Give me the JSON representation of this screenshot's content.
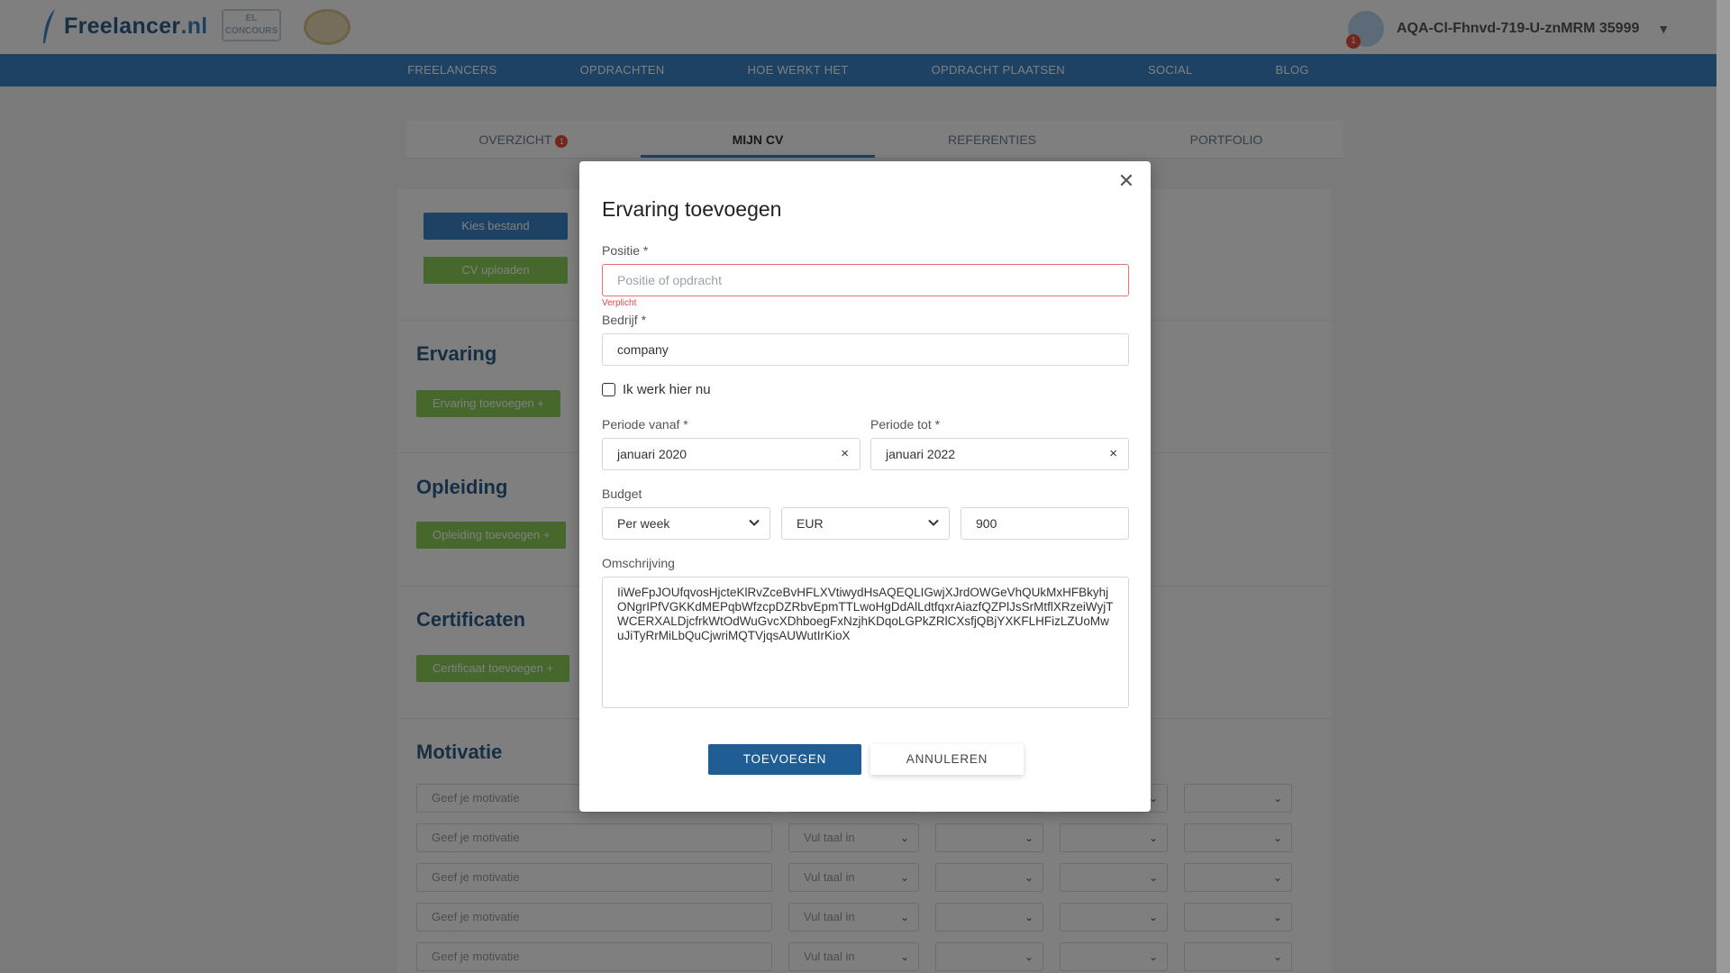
{
  "app": {
    "logo_text_main": "Freelancer",
    "logo_text_suffix": ".nl",
    "award_badge_text": "EL\nCONCOURS",
    "user_name": "AQA-Cl-Fhnvd-719-U-znMRM 35999",
    "user_notification_count": "1"
  },
  "nav": {
    "items": [
      "FREELANCERS",
      "OPDRACHTEN",
      "HOE WERKT HET",
      "OPDRACHT PLAATSEN",
      "SOCIAL",
      "BLOG"
    ]
  },
  "subtabs": {
    "items": [
      "OVERZICHT",
      "MIJN CV",
      "REFERENTIES",
      "PORTFOLIO"
    ],
    "overview_badge": "1",
    "active": "MIJN CV"
  },
  "page": {
    "choose_file_label": "Kies bestand",
    "upload_cv_label": "CV uploaden",
    "sections": {
      "experience_title": "Ervaring",
      "experience_button": "Ervaring toevoegen +",
      "education_title": "Opleiding",
      "education_button": "Opleiding toevoegen +",
      "certificates_title": "Certificaten",
      "certificates_button": "Certificaat toevoegen +",
      "motivation_title": "Motivatie"
    },
    "motivation_rows": {
      "input_placeholder": "Geef je motivatie",
      "select_placeholder": "Vul taal in"
    }
  },
  "modal": {
    "title": "Ervaring toevoegen",
    "position_label": "Positie *",
    "position_placeholder": "Positie of opdracht",
    "position_value": "",
    "position_error": "Verplicht",
    "company_label": "Bedrijf *",
    "company_value": "company",
    "currently_working_label": "Ik werk hier nu",
    "currently_working_checked": false,
    "period_from_label": "Periode vanaf *",
    "period_from_value": "januari 2020",
    "period_to_label": "Periode tot *",
    "period_to_value": "januari 2022",
    "budget_label": "Budget",
    "budget_period_value": "Per week",
    "budget_currency_value": "EUR",
    "budget_amount_value": "900",
    "description_label": "Omschrijving",
    "description_value": "IiWeFpJOUfqvosHjcteKlRvZceBvHFLXVtiwydHsAQEQLIGwjXJrdOWGeVhQUkMxHFBkyhjONgrIPfVGKKdMEPqbWfzcpDZRbvEpmTTLwoHgDdAlLdtfqxrAiazfQZPlJsSrMtflXRzeiWyjTWCERXALDjcfrkWtOdWuGvcXDhboegFxNzjhKDqoLGPkZRlCXsfjQBjYXKFLHFizLZUoMwuJiTyRrMiLbQuCjwriMQTVjqsAUWutIrKioX",
    "add_button": "TOEVOEGEN",
    "cancel_button": "ANNULEREN",
    "close_icon": "close-icon"
  },
  "colors": {
    "primary": "#1f5e94",
    "nav_blue": "#3d85c6",
    "accent_green": "#8fd15a",
    "error_red": "#d84b4b"
  }
}
